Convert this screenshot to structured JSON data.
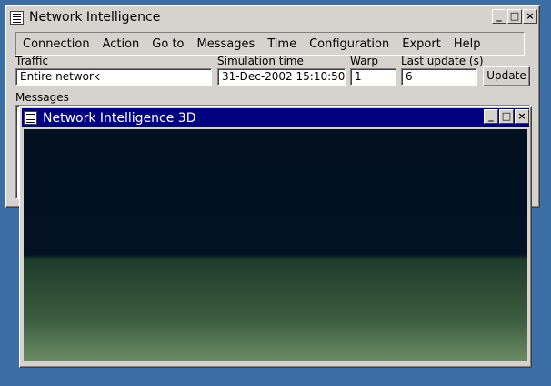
{
  "main_window": {
    "title": "Network Intelligence",
    "menu": [
      "Connection",
      "Action",
      "Go to",
      "Messages",
      "Time",
      "Configuration",
      "Export",
      "Help"
    ],
    "traffic_label": "Traffic",
    "traffic_value": "Entire network",
    "sim_time_label": "Simulation time",
    "sim_time_value": "31-Dec-2002 15:10:50",
    "warp_label": "Warp",
    "warp_value": "1",
    "last_update_label": "Last update (s)",
    "last_update_value": "6",
    "update_button": "Update",
    "messages_label": "Messages"
  },
  "window_3d": {
    "title": "Network Intelligence 3D"
  },
  "colors": {
    "desktop": "#3a6ea5",
    "active_title": "#000080",
    "window_face": "#d6d3ce"
  },
  "icons": [
    "window-menu-icon",
    "minimize-icon",
    "maximize-icon",
    "close-icon"
  ]
}
